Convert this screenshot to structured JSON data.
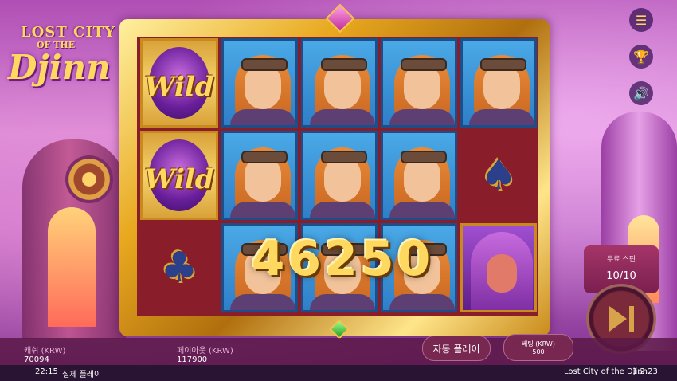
{
  "logo": {
    "line1": "LOST CITY",
    "line2": "OF THE",
    "line3": "Djinn"
  },
  "side_buttons": [
    {
      "icon": "menu-icon",
      "glyph": "☰"
    },
    {
      "icon": "trophy-icon",
      "glyph": "🏆"
    },
    {
      "icon": "speaker-icon",
      "glyph": "🔊"
    }
  ],
  "reels": {
    "wild_label": "Wild",
    "grid": [
      [
        "wild",
        "pilot",
        "pilot",
        "pilot",
        "pilot"
      ],
      [
        "wild",
        "pilot",
        "pilot",
        "pilot",
        "spade"
      ],
      [
        "club",
        "pilot",
        "pilot",
        "pilot",
        "djinn"
      ]
    ]
  },
  "win_amount": "46250",
  "free_spins": {
    "label": "무료 스핀",
    "count": "10/10"
  },
  "balance": {
    "cash_label": "캐쉬 (KRW)",
    "cash_value": "70094",
    "payout_label": "페이아웃 (KRW)",
    "payout_value": "117900"
  },
  "controls": {
    "autoplay_label": "자동 플레이",
    "bet_label": "베팅 (KRW)",
    "bet_value": "500"
  },
  "status": {
    "time": "22:15",
    "mode": "실제 플레이",
    "game_name": "Lost City of the Djinn",
    "version": "1.2.23"
  },
  "colors": {
    "frame_gold": "#e8a81f",
    "reel_bg": "#8a1d2a",
    "accent": "#ffd860"
  }
}
